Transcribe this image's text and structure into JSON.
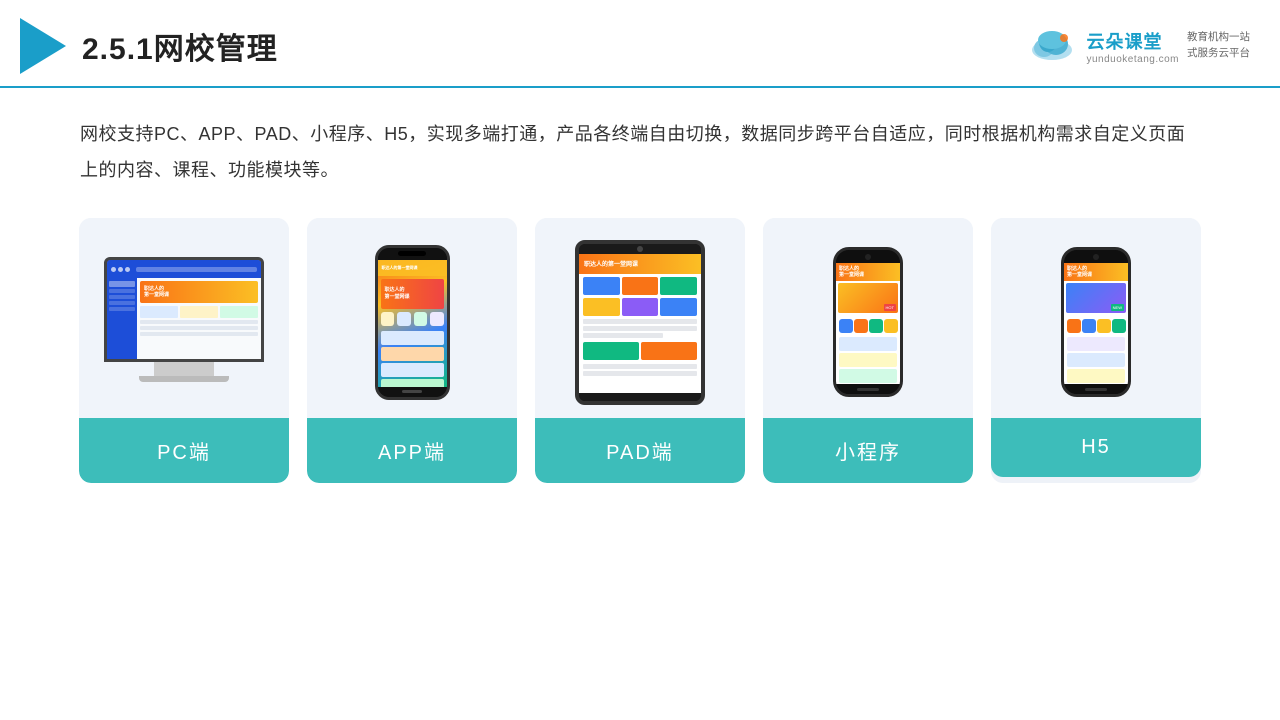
{
  "header": {
    "title": "2.5.1网校管理",
    "brand_name": "云朵课堂",
    "brand_url": "yunduoketang.com",
    "brand_slogan_line1": "教育机构一站",
    "brand_slogan_line2": "式服务云平台"
  },
  "description": {
    "text": "网校支持PC、APP、PAD、小程序、H5，实现多端打通，产品各终端自由切换，数据同步跨平台自适应，同时根据机构需求自定义页面上的内容、课程、功能模块等。"
  },
  "cards": [
    {
      "id": "pc",
      "label": "PC端"
    },
    {
      "id": "app",
      "label": "APP端"
    },
    {
      "id": "pad",
      "label": "PAD端"
    },
    {
      "id": "miniapp",
      "label": "小程序"
    },
    {
      "id": "h5",
      "label": "H5"
    }
  ],
  "colors": {
    "accent": "#1a9ec9",
    "card_bg": "#eef2f8",
    "card_label_bg": "#3dbdba",
    "card_label_text": "#ffffff"
  }
}
